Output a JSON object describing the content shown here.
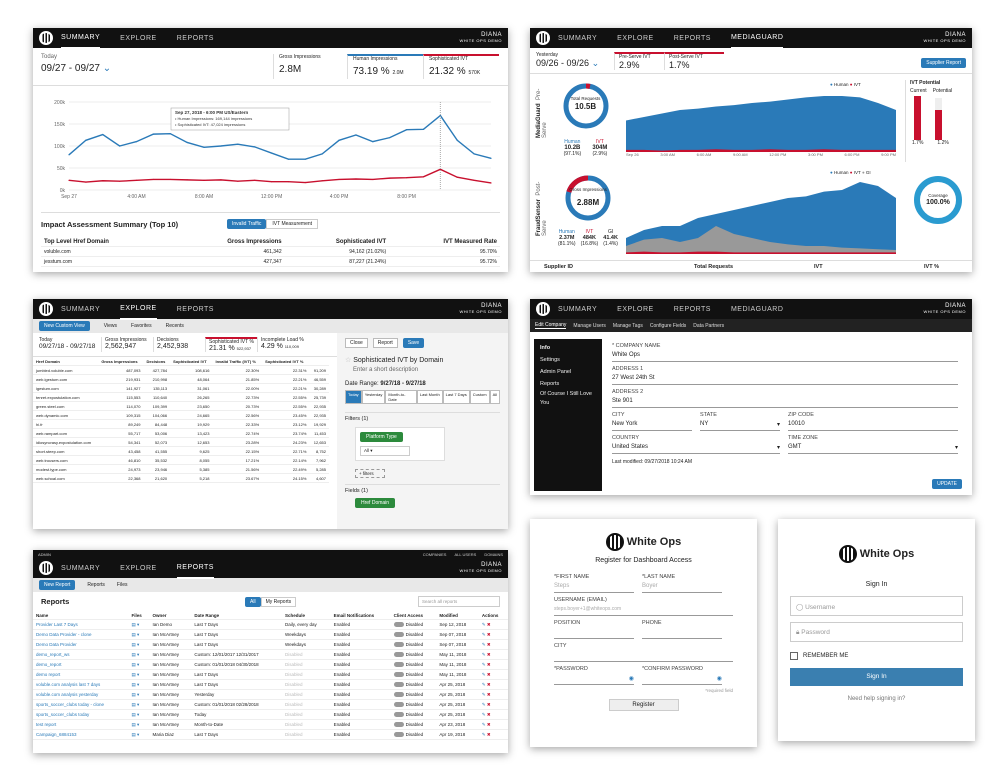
{
  "nav": {
    "summary": "SUMMARY",
    "explore": "EXPLORE",
    "reports": "REPORTS",
    "mediaguard": "MEDIAGUARD",
    "user": "DIANA",
    "user_sub": "WHITE OPS DEMO"
  },
  "p1": {
    "today": "Today",
    "range": "09/27 - 09/27",
    "metrics": [
      {
        "label": "Gross Impressions",
        "value": "2.8M",
        "sub": ""
      },
      {
        "label": "Human Impressions",
        "value": "73.19 %",
        "sub": "2.0M"
      },
      {
        "label": "Sophisticated IVT",
        "value": "21.32 %",
        "sub": "570K"
      }
    ],
    "tooltip": [
      "Sep 27, 2018 - 6:00 PM US/Eastern",
      "Human Impressions: 169,144 impressions",
      "Sophisticated IVT: 47,024 impressions"
    ],
    "yticks": [
      "200k",
      "150k",
      "100k",
      "50k",
      "0k"
    ],
    "xticks": [
      "Sep 27",
      "4:00 AM",
      "8:00 AM",
      "12:00 PM",
      "4:00 PM",
      "8:00 PM"
    ],
    "impact_title": "Impact Assessment Summary (Top 10)",
    "toggle": [
      "Invalid Traffic",
      "IVT Measurement"
    ],
    "cols": [
      "Top Level Href Domain",
      "Gross Impressions",
      "Sophisticated IVT",
      "IVT Measured Rate"
    ],
    "rows": [
      [
        "voluble.com",
        "461,342",
        "94,162 (21.02%)",
        "95.70%"
      ],
      [
        "jesstum.com",
        "427,347",
        "87,227 (21.24%)",
        "95.72%"
      ]
    ]
  },
  "p2": {
    "yesterday": "Yesterday",
    "range": "09/26 - 09/26",
    "pre": "Pre-Serve IVT",
    "pre_val": "2.9%",
    "post": "Post-Serve IVT",
    "post_val": "1.7%",
    "supplier_btn": "Supplier Report",
    "side1": "MediaGuard",
    "side1b": "Pre-Serve",
    "side2": "FraudSensor",
    "side2b": "Post-Serve",
    "donut1": {
      "label": "Total Requests",
      "value": "10.5B",
      "human": "10.2B",
      "ivt": "304M",
      "hp": "(97.1%)",
      "ip": "(2.9%)"
    },
    "donut2": {
      "label": "Gross Impressions",
      "value": "2.88M",
      "human": "2.37M",
      "ivt": "484K",
      "gi": "41.4K",
      "hp": "(81.1%)",
      "ip": "(16.8%)",
      "gp": "(1.4%)"
    },
    "legend": [
      "Human",
      "IVT",
      "GI"
    ],
    "ivt_potential": "IVT Potential",
    "current": "Current",
    "potential": "Potential",
    "cur_val": "1.7%",
    "pot_val": "1.2%",
    "coverage": "Coverage",
    "coverage_val": "100.0%",
    "footer": [
      "Supplier ID",
      "Total Requests",
      "IVT",
      "IVT %"
    ]
  },
  "p3": {
    "new_view": "New Custom View",
    "views": "Views",
    "favorites": "Favorites",
    "recents": "Recents",
    "range": "09/27/18 - 09/27/18",
    "metrics": [
      {
        "l": "Gross Impressions",
        "v": "2,562,947"
      },
      {
        "l": "Decisions",
        "v": "2,452,938"
      },
      {
        "l": "Sophisticated IVT %",
        "v": "21.31 %",
        "s": "522,937"
      },
      {
        "l": "Incomplete Load %",
        "v": "4.29 %",
        "s": "110,009"
      }
    ],
    "cols": [
      "Href Domain",
      "Gross Impressions",
      "Decisions",
      "Sophisticated IVT",
      "Invalid Traffic (IVT) %",
      "Sophisticated IVT %",
      ""
    ],
    "rows": [
      [
        "jumbled.voluble.com",
        "487,093",
        "427,784",
        "108,616",
        "22.30%",
        "22.31%",
        "91,209"
      ],
      [
        "web.igestum.com",
        "219,931",
        "210,998",
        "48,064",
        "21.85%",
        "22.21%",
        "46,559"
      ],
      [
        "igestum.com",
        "141,927",
        "135,113",
        "31,061",
        "22.00%",
        "22.21%",
        "30,289"
      ],
      [
        "tenret.expostulation.com",
        "115,553",
        "110,640",
        "26,265",
        "22.73%",
        "22.55%",
        "25,739"
      ],
      [
        "green.steel.com",
        "114,070",
        "109,399",
        "23,650",
        "20.73%",
        "22.55%",
        "22,935"
      ],
      [
        "web.dynamic.com",
        "109,315",
        "104,066",
        "24,665",
        "22.56%",
        "23.45%",
        "22,935"
      ],
      [
        "hi.fr",
        "89,249",
        "84,448",
        "19,929",
        "22.33%",
        "23.12%",
        "19,929"
      ],
      [
        "web.rampart.com",
        "55,717",
        "53,006",
        "13,423",
        "22.74%",
        "23.74%",
        "11,453"
      ],
      [
        "idiosyncrasy.expostulation.com",
        "54,341",
        "52,073",
        "12,653",
        "23.28%",
        "24.23%",
        "12,653"
      ],
      [
        "short.steep.com",
        "43,458",
        "41,555",
        "9,625",
        "22.15%",
        "22.71%",
        "8,752"
      ],
      [
        "web.trousers.com",
        "46,810",
        "35,532",
        "8,055",
        "17.21%",
        "22.14%",
        "7,962"
      ],
      [
        "modest.type.com",
        "24,973",
        "23,946",
        "5,385",
        "21.56%",
        "22.49%",
        "5,285"
      ],
      [
        "web.schoal.com",
        "22,368",
        "21,620",
        "5,218",
        "23.67%",
        "24.15%",
        "4,607"
      ]
    ],
    "close": "Close",
    "report": "Report",
    "save": "Save",
    "title": "Sophisticated IVT by Domain",
    "desc": "Enter a short description",
    "date_range_label": "Date Range:",
    "date_range": "9/27/18 - 9/27/18",
    "ranges": [
      "Today",
      "Yesterday",
      "Month-to-Date",
      "Last Month",
      "Last 7 Days",
      "Custom",
      "All"
    ],
    "filters": "Filters (1)",
    "platform": "Platform Type",
    "all": "All",
    "add_filters": "+ filters",
    "fields": "Fields (1)",
    "href": "Href Domain"
  },
  "p4": {
    "tabs": [
      "Edit Company",
      "Manage Users",
      "Manage Tags",
      "Configure Fields",
      "Data Partners"
    ],
    "side": [
      "Info",
      "Settings",
      "Admin Panel",
      "Reports",
      "Of Course I Still Love You"
    ],
    "company_l": "* COMPANY NAME",
    "company": "White Ops",
    "addr1_l": "ADDRESS 1",
    "addr1": "27 West 24th St",
    "addr2_l": "ADDRESS 2",
    "addr2": "Ste 901",
    "city_l": "CITY",
    "city": "New York",
    "state_l": "STATE",
    "state": "NY",
    "zip_l": "ZIP CODE",
    "zip": "10010",
    "country_l": "COUNTRY",
    "country": "United States",
    "tz_l": "TIME ZONE",
    "tz": "GMT",
    "modified": "Last modified: 09/27/2018 10:24 AM",
    "update": "UPDATE"
  },
  "p5": {
    "admin": "ADMIN",
    "top_links": [
      "COMPANIES",
      "ALL USERS",
      "DOMAINS"
    ],
    "new_report": "New Report",
    "reports_tab": "Reports",
    "files_tab": "Files",
    "title": "Reports",
    "all": "All",
    "mine": "My Reports",
    "search": "Search all reports",
    "cols": [
      "Name",
      "Files",
      "Owner",
      "Date Range",
      "Schedule",
      "Email Notifications",
      "Client Access",
      "Modified",
      "Actions"
    ],
    "rows": [
      [
        "Provider Last 7 Days",
        "Ian Demo",
        "Last 7 Days",
        "Daily, every day",
        "Enabled",
        "Disabled",
        "Sep 12, 2018"
      ],
      [
        "Demo Data Provider - clone",
        "Ian McArtney",
        "Last 7 Days",
        "Weekdays",
        "Enabled",
        "Disabled",
        "Sep 07, 2018"
      ],
      [
        "Demo Data Provider",
        "Ian McArtney",
        "Last 7 Days",
        "Weekdays",
        "Enabled",
        "Disabled",
        "Sep 07, 2018"
      ],
      [
        "demo_report_ws",
        "Ian McArtney",
        "Custom: 12/01/2017 12/31/2017",
        "Disabled",
        "Enabled",
        "Disabled",
        "May 11, 2018"
      ],
      [
        "demo_report",
        "Ian McArtney",
        "Custom: 01/01/2018 04/30/2018",
        "Disabled",
        "Enabled",
        "Disabled",
        "May 11, 2018"
      ],
      [
        "demo report",
        "Ian McArtney",
        "Last 7 Days",
        "Disabled",
        "Enabled",
        "Disabled",
        "May 11, 2018"
      ],
      [
        "voluble.com analysis last 7 days",
        "Ian McArtney",
        "Last 7 Days",
        "Disabled",
        "Enabled",
        "Disabled",
        "Apr 25, 2018"
      ],
      [
        "voluble.com analysis yesterday",
        "Ian McArtney",
        "Yesterday",
        "Disabled",
        "Enabled",
        "Disabled",
        "Apr 25, 2018"
      ],
      [
        "sports_soccer_clubs today - clone",
        "Ian McArtney",
        "Custom: 01/01/2018 02/28/2018",
        "Disabled",
        "Enabled",
        "Disabled",
        "Apr 25, 2018"
      ],
      [
        "sports_soccer_clubs today",
        "Ian McArtney",
        "Today",
        "Disabled",
        "Enabled",
        "Disabled",
        "Apr 25, 2018"
      ],
      [
        "test report",
        "Ian McArtney",
        "Month-to-Date",
        "Disabled",
        "Enabled",
        "Disabled",
        "Apr 23, 2018"
      ],
      [
        "Campaign_6884153",
        "Maria Diaz",
        "Last 7 Days",
        "Disabled",
        "Enabled",
        "Disabled",
        "Apr 19, 2018"
      ]
    ]
  },
  "p6": {
    "brand": "White Ops",
    "title": "Register for Dashboard Access",
    "first_l": "*FIRST NAME",
    "first_ph": "Steps",
    "last_l": "*LAST NAME",
    "last_ph": "Boyer",
    "email_l": "USERNAME (EMAIL)",
    "email_ph": "steps.boyer+1@whiteops.com",
    "position_l": "POSITION",
    "phone_l": "PHONE",
    "city_l": "CITY",
    "pw_l": "*PASSWORD",
    "cpw_l": "*CONFIRM PASSWORD",
    "required": "*required field",
    "register": "Register"
  },
  "p7": {
    "brand": "White Ops",
    "title": "Sign In",
    "username": "Username",
    "password": "Password",
    "remember": "REMEMBER ME",
    "signin": "Sign In",
    "help": "Need help signing in?"
  },
  "chart_data": [
    {
      "type": "line",
      "title": "",
      "x": [
        "Sep 27",
        "4:00 AM",
        "8:00 AM",
        "12:00 PM",
        "4:00 PM",
        "8:00 PM"
      ],
      "ylim": [
        0,
        200000
      ],
      "series": [
        {
          "name": "Human Impressions",
          "values": [
            80000,
            113000,
            126000,
            100000,
            110000,
            127000,
            128000,
            108000,
            97000,
            100000,
            104000,
            98000,
            84000,
            70000,
            70000,
            82000,
            113000,
            125000,
            110000,
            119000,
            137000,
            138000,
            169144,
            113000,
            82000,
            72000
          ]
        },
        {
          "name": "Sophisticated IVT",
          "values": [
            22000,
            18000,
            21000,
            20000,
            22000,
            24000,
            24000,
            23000,
            22000,
            23000,
            20000,
            22000,
            19000,
            19000,
            17000,
            21000,
            24000,
            25000,
            24000,
            27000,
            28000,
            30000,
            47024,
            29000,
            22000,
            16000
          ]
        }
      ]
    }
  ],
  "colors": {
    "blue": "#2a7ab8",
    "red": "#c8102e",
    "nav": "#111111",
    "green": "#2c8a3c"
  }
}
